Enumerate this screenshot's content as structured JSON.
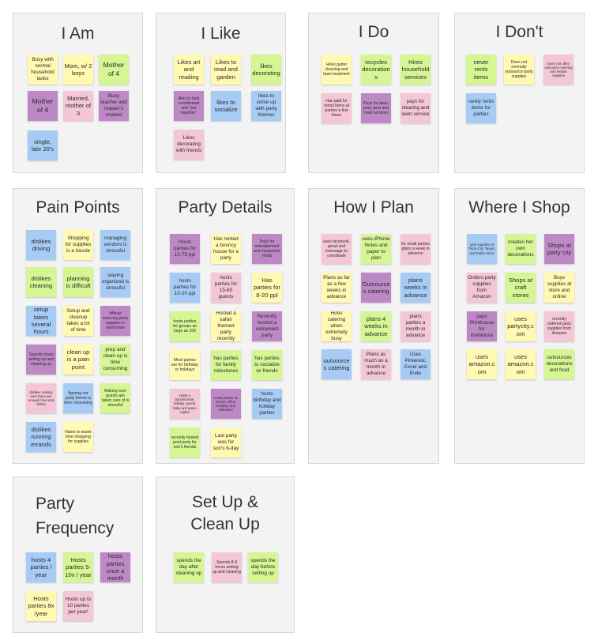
{
  "colors": {
    "yellow": "#fff9b1",
    "green": "#d5f692",
    "purple": "#be88c7",
    "blue": "#a6ccf5",
    "pink": "#f5c6d8",
    "frame_background": "#f3f3f3",
    "frame_border": "#d7d7d7"
  },
  "frames": [
    {
      "title": "I Am",
      "notes": [
        {
          "text": "Busy with normal household tasks",
          "color": "yellow"
        },
        {
          "text": "Mom, w/ 2 boys",
          "color": "yellow"
        },
        {
          "text": "Mother of 4",
          "color": "green"
        },
        {
          "text": "Mother of 4",
          "color": "purple"
        },
        {
          "text": "Married, mother of 3",
          "color": "pink"
        },
        {
          "text": "Busy teacher and master's student",
          "color": "purple"
        },
        {
          "text": "single, late 20's",
          "color": "blue"
        }
      ]
    },
    {
      "title": "I Like",
      "notes": [
        {
          "text": "Likes art and reading",
          "color": "yellow"
        },
        {
          "text": "Likes to read and garden",
          "color": "yellow"
        },
        {
          "text": "likes decorating",
          "color": "green"
        },
        {
          "text": "likes to look coordinated and \"put together\"",
          "color": "purple"
        },
        {
          "text": "likes to socialize",
          "color": "blue"
        },
        {
          "text": "likes to come up with party themes",
          "color": "blue"
        },
        {
          "text": "Likes decorating with friends",
          "color": "pink"
        }
      ]
    },
    {
      "title": "I Do",
      "notes": [
        {
          "text": "Hires gutter cleaning and lawn treatment",
          "color": "yellow"
        },
        {
          "text": "recycles decorations",
          "color": "green"
        },
        {
          "text": "Hires household services",
          "color": "green"
        },
        {
          "text": "Has paid for rental items at parties a few times",
          "color": "pink"
        },
        {
          "text": "Pays for lawn, pool, pest and maid services",
          "color": "purple"
        },
        {
          "text": "pays for clearing and lawn service",
          "color": "pink"
        }
      ]
    },
    {
      "title": "I Don't",
      "notes": [
        {
          "text": "never rents items",
          "color": "green"
        },
        {
          "text": "Does not normally outsource party supplies",
          "color": "yellow"
        },
        {
          "text": "Does not often outsource catering and rentals supplies",
          "color": "pink"
        },
        {
          "text": "rarely rents items for parties",
          "color": "blue"
        }
      ]
    },
    {
      "title": "Pain Points",
      "notes": [
        {
          "text": "dislikes driving",
          "color": "blue"
        },
        {
          "text": "Shopping for supplies is a hassle",
          "color": "yellow"
        },
        {
          "text": "managing vendors is stressful",
          "color": "blue"
        },
        {
          "text": "dislikes cleaning",
          "color": "green"
        },
        {
          "text": "planning is difficult",
          "color": "green"
        },
        {
          "text": "staying organized is stressful",
          "color": "blue"
        },
        {
          "text": "setup takes several hours",
          "color": "blue"
        },
        {
          "text": "Setup and cleanup takes a lot of time",
          "color": "yellow"
        },
        {
          "text": "difficult sourcing party supplies in small town",
          "color": "purple"
        },
        {
          "text": "Spends hours setting up and cleaning up",
          "color": "purple"
        },
        {
          "text": "clean up is a pain point",
          "color": "yellow"
        },
        {
          "text": "prep and clean up is time consuming",
          "color": "green"
        },
        {
          "text": "dislikes making sure there are enough food and drinks",
          "color": "pink"
        },
        {
          "text": "figuring out party theme is time consuming",
          "color": "blue"
        },
        {
          "text": "Making sure guests are taken care of is stressful",
          "color": "green"
        },
        {
          "text": "dislikes running errands",
          "color": "blue"
        },
        {
          "text": "Hates to waste time shopping for supplies",
          "color": "yellow"
        }
      ]
    },
    {
      "title": "Party Details",
      "notes": [
        {
          "text": "Hosts parties for 15-75 ppl",
          "color": "purple"
        },
        {
          "text": "Has rented a bouncy house for a party",
          "color": "yellow"
        },
        {
          "text": "Pays for entertainment and equipment rental",
          "color": "purple"
        },
        {
          "text": "hosts parties for 10-20 ppl",
          "color": "blue"
        },
        {
          "text": "hosts parties for 15-65 guests",
          "color": "pink"
        },
        {
          "text": "Has parties for 8-20 ppl",
          "color": "yellow"
        },
        {
          "text": "hosts parties for groups as large as 100",
          "color": "green"
        },
        {
          "text": "Hosted a safari themed party recently",
          "color": "yellow"
        },
        {
          "text": "Recently hosted a retirement party",
          "color": "purple"
        },
        {
          "text": "Most parties are for birthday or holidays",
          "color": "yellow"
        },
        {
          "text": "has parties for family milestones",
          "color": "green"
        },
        {
          "text": "has parties to socialize w/ friends",
          "color": "green"
        },
        {
          "text": "Holds a bachelorette, holiday, sports, baby and game nights",
          "color": "pink"
        },
        {
          "text": "Hosts parties for church, office, holidays and birthdays",
          "color": "purple"
        },
        {
          "text": "hosts birthday and holiday parties",
          "color": "blue"
        },
        {
          "text": "recently hosted pool party for son's friends",
          "color": "green"
        },
        {
          "text": "Last party was for son's b-day",
          "color": "yellow"
        }
      ]
    },
    {
      "title": "How I Plan",
      "notes": [
        {
          "text": "uses facebook, gmail and imessage to coordinate",
          "color": "pink"
        },
        {
          "text": "uses iPhone Notes and paper to plan",
          "color": "green"
        },
        {
          "text": "for small parties plans a week in advance",
          "color": "pink"
        },
        {
          "text": "Plans as far as a few weeks in advance",
          "color": "yellow"
        },
        {
          "text": "Outsources catering",
          "color": "purple"
        },
        {
          "text": "plans weeks in advance",
          "color": "blue"
        },
        {
          "text": "Hires catering when extremely busy",
          "color": "yellow"
        },
        {
          "text": "plans 4 weeks in advance",
          "color": "green"
        },
        {
          "text": "plans parties a month in advance",
          "color": "pink"
        },
        {
          "text": "outsources catering",
          "color": "blue"
        },
        {
          "text": "Plans as much as a month in advance",
          "color": "pink"
        },
        {
          "text": "Uses Pinterest, Excel and Evite",
          "color": "blue"
        }
      ]
    },
    {
      "title": "Where I Shop",
      "notes": [
        {
          "text": "gets supplies at Party City, Target, and Dollar Store",
          "color": "blue"
        },
        {
          "text": "creates her own decorations",
          "color": "green"
        },
        {
          "text": "Shops at party city",
          "color": "purple"
        },
        {
          "text": "Orders party supplies from Amazon",
          "color": "pink"
        },
        {
          "text": "Shops at craft stores",
          "color": "green"
        },
        {
          "text": "Buys supplies at store and online",
          "color": "yellow"
        },
        {
          "text": "pays Printhouse for invitations",
          "color": "purple"
        },
        {
          "text": "uses partycity.com",
          "color": "yellow"
        },
        {
          "text": "recently ordered party supplies from Amazon",
          "color": "pink"
        },
        {
          "text": "uses amazon.com",
          "color": "yellow"
        },
        {
          "text": "uses amazon.com",
          "color": "yellow"
        },
        {
          "text": "outsources decorations and food",
          "color": "green"
        }
      ]
    },
    {
      "title": "Party\nFrequency",
      "notes": [
        {
          "text": "hosts 4 parties / year",
          "color": "blue"
        },
        {
          "text": "Hosts parties 5-10x / year",
          "color": "green"
        },
        {
          "text": "hosts parties once a month",
          "color": "purple"
        },
        {
          "text": "Hosts parties 8x /year",
          "color": "yellow"
        },
        {
          "text": "Hosts up to 10 parties per year!",
          "color": "pink"
        }
      ]
    },
    {
      "title": "Set Up &\nClean Up",
      "notes": [
        {
          "text": "spends the day after cleaning up",
          "color": "green"
        },
        {
          "text": "Spends 8-9 hours setting up and cleaning",
          "color": "pink"
        },
        {
          "text": "spends the day before setting up",
          "color": "green"
        }
      ]
    }
  ]
}
